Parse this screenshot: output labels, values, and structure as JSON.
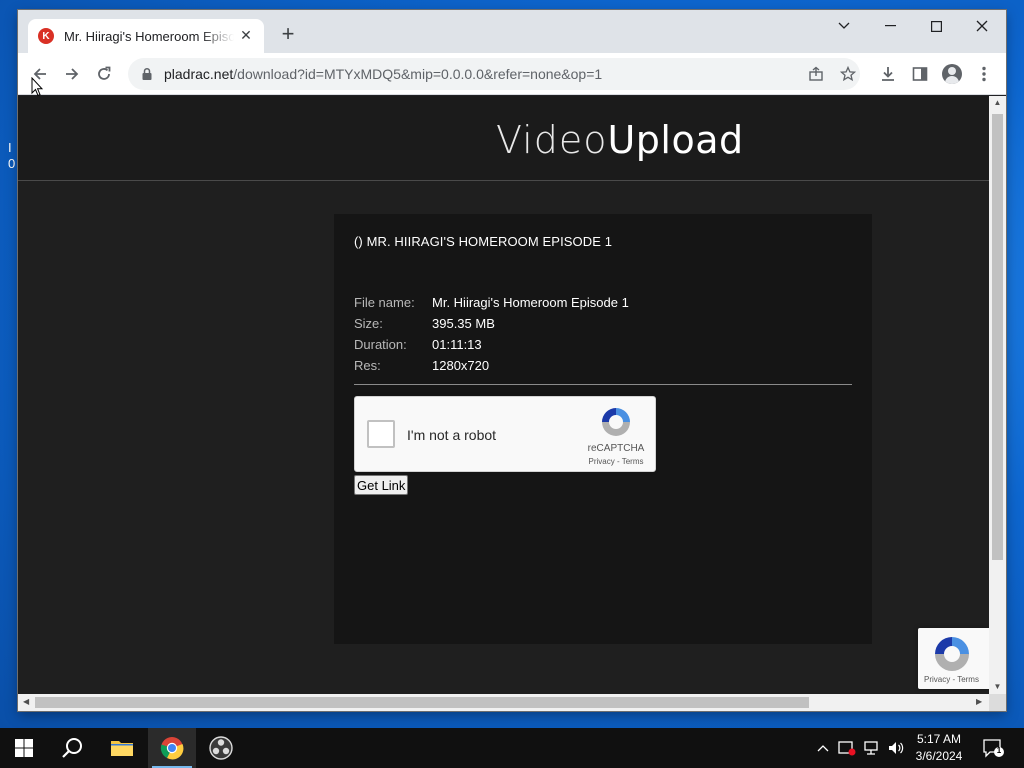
{
  "browser": {
    "tab_title": "Mr. Hiiragi's Homeroom Episode",
    "tab_favicon_letter": "K",
    "url_host": "pladrac.net",
    "url_path": "/download?id=MTYxMDQ5&mip=0.0.0.0&refer=none&op=1"
  },
  "site": {
    "logo_thin": "Video",
    "logo_bold": "Upload"
  },
  "file_card": {
    "title": "() MR. HIIRAGI'S HOMEROOM EPISODE 1",
    "rows": [
      {
        "label": "File name:",
        "value": "Mr. Hiiragi's Homeroom Episode 1"
      },
      {
        "label": "Size:",
        "value": "395.35 MB"
      },
      {
        "label": "Duration:",
        "value": "01:11:13"
      },
      {
        "label": "Res:",
        "value": "1280x720"
      }
    ],
    "button_label": "Get Link"
  },
  "recaptcha": {
    "label": "I'm not a robot",
    "brand": "reCAPTCHA",
    "links": "Privacy - Terms",
    "badge_links": "Privacy - Terms"
  },
  "desktop": {
    "fragment": "I\n0"
  },
  "taskbar": {
    "time": "5:17 AM",
    "date": "3/6/2024",
    "notification_count": "1"
  },
  "colors": {
    "page_bg": "#1f1f1f",
    "card_bg": "#151515",
    "captcha_blue": "#4a90e2",
    "desktop_blue": "#0d66cf"
  }
}
